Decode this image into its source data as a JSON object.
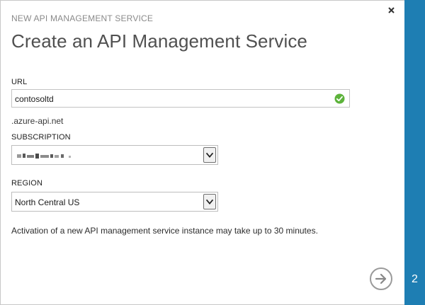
{
  "header": {
    "subtitle": "NEW API MANAGEMENT SERVICE",
    "title": "Create an API Management Service"
  },
  "url": {
    "label": "URL",
    "value": "contosoltd",
    "suffix": ".azure-api.net",
    "valid_icon": "check-circle-icon",
    "valid_color": "#5db33b"
  },
  "subscription": {
    "label": "SUBSCRIPTION",
    "value_obscured": true
  },
  "region": {
    "label": "REGION",
    "value": "North Central US"
  },
  "note": "Activation of a new API management service instance may take up to 30 minutes.",
  "footer": {
    "step": "2",
    "next_icon": "arrow-right-icon",
    "close_icon": "close-icon"
  },
  "colors": {
    "accent": "#1e7eb3"
  }
}
